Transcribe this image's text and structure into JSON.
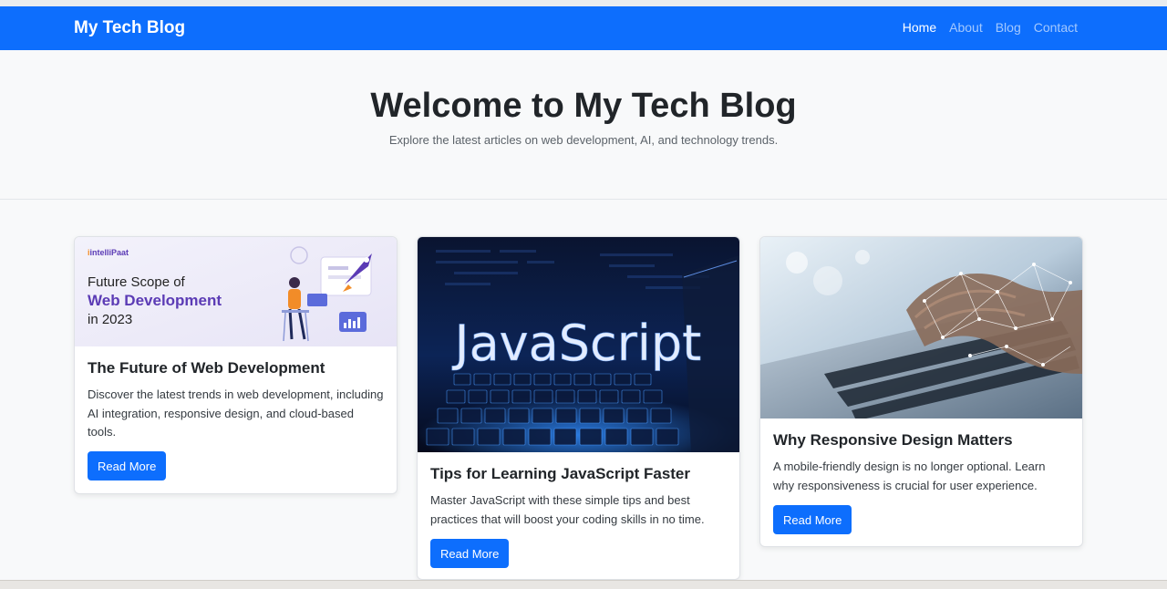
{
  "navbar": {
    "brand": "My Tech Blog",
    "links": [
      {
        "label": "Home",
        "active": true
      },
      {
        "label": "About"
      },
      {
        "label": "Blog"
      },
      {
        "label": "Contact"
      }
    ]
  },
  "hero": {
    "title": "Welcome to My Tech Blog",
    "subtitle": "Explore the latest articles on web development, AI, and technology trends."
  },
  "cards": [
    {
      "image": {
        "logo": "intelliPaat",
        "line1": "Future Scope of",
        "line2": "Web Development",
        "line3": "in 2023"
      },
      "title": "The Future of Web Development",
      "text": "Discover the latest trends in web development, including AI integration, responsive design, and cloud-based tools.",
      "button": "Read More"
    },
    {
      "image": {
        "word": "JavaScript"
      },
      "title": "Tips for Learning JavaScript Faster",
      "text": "Master JavaScript with these simple tips and best practices that will boost your coding skills in no time.",
      "button": "Read More"
    },
    {
      "title": "Why Responsive Design Matters",
      "text": "A mobile-friendly design is no longer optional. Learn why responsiveness is crucial for user experience.",
      "button": "Read More"
    }
  ],
  "colors": {
    "primary": "#0d6efd",
    "background": "#f8f9fa",
    "text": "#212529"
  }
}
